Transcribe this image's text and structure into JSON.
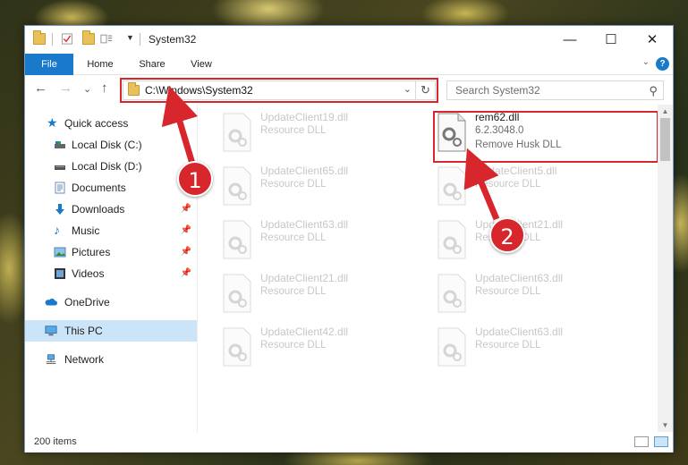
{
  "window": {
    "title": "System32",
    "minimize": "—",
    "maximize": "☐",
    "close": "✕"
  },
  "ribbon": {
    "tabs": [
      "File",
      "Home",
      "Share",
      "View"
    ],
    "collapse": "⌄",
    "help": "?"
  },
  "nav": {
    "back": "←",
    "forward": "→",
    "recent": "⌄",
    "up": "↑",
    "address": "C:\\Windows\\System32",
    "address_dropdown": "⌄",
    "refresh": "↻",
    "search_placeholder": "Search System32",
    "search_icon": "⚲"
  },
  "sidebar": {
    "items": [
      {
        "label": "Quick access",
        "icon": "star-icon",
        "pinned": false
      },
      {
        "label": "Local Disk (C:)",
        "icon": "drive-icon",
        "pinned": false
      },
      {
        "label": "Local Disk (D:)",
        "icon": "drive-icon",
        "pinned": false
      },
      {
        "label": "Documents",
        "icon": "documents-icon",
        "pinned": false
      },
      {
        "label": "Downloads",
        "icon": "download-icon",
        "pinned": true
      },
      {
        "label": "Music",
        "icon": "music-icon",
        "pinned": true
      },
      {
        "label": "Pictures",
        "icon": "pictures-icon",
        "pinned": true
      },
      {
        "label": "Videos",
        "icon": "videos-icon",
        "pinned": true
      },
      {
        "label": "OneDrive",
        "icon": "cloud-icon",
        "pinned": false
      },
      {
        "label": "This PC",
        "icon": "computer-icon",
        "pinned": false,
        "selected": true
      },
      {
        "label": "Network",
        "icon": "network-icon",
        "pinned": false
      }
    ],
    "pin_glyph": "📌"
  },
  "files": {
    "highlighted": {
      "name": "rem62.dll",
      "version": "6.2.3048.0",
      "description": "Remove Husk DLL"
    },
    "left_column": [
      {
        "name": "UpdateClient19.dll",
        "type": "Resource DLL"
      },
      {
        "name": "UpdateClient65.dll",
        "type": "Resource DLL"
      },
      {
        "name": "UpdateClient63.dll",
        "type": "Resource DLL"
      },
      {
        "name": "UpdateClient21.dll",
        "type": "Resource DLL"
      },
      {
        "name": "UpdateClient42.dll",
        "type": "Resource DLL"
      }
    ],
    "right_column": [
      {
        "name": "UpdateClient5.dll",
        "type": "Resource DLL"
      },
      {
        "name": "UpdateClient21.dll",
        "type": "Resource DLL"
      },
      {
        "name": "UpdateClient63.dll",
        "type": "Resource DLL"
      },
      {
        "name": "UpdateClient63.dll",
        "type": "Resource DLL"
      }
    ]
  },
  "status": {
    "item_count": "200 items"
  },
  "callouts": {
    "one": "1",
    "two": "2",
    "color": "#d7262c"
  },
  "colors": {
    "accent": "#1979ca",
    "selected": "#cce4f7",
    "highlight": "#d7262c"
  }
}
